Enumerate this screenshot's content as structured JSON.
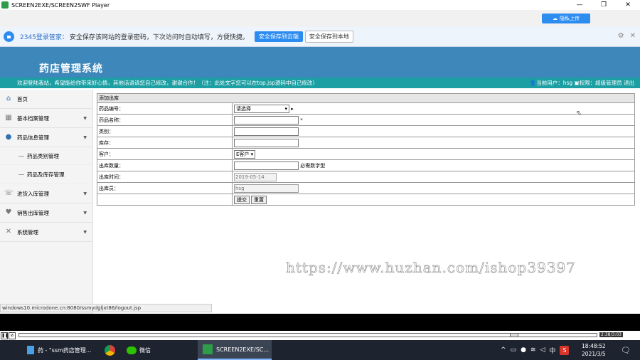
{
  "window": {
    "title": "SCREEN2EXE/SCREEN2SWF Player",
    "controls": [
      "—",
      "❐",
      "✕"
    ]
  },
  "cloud_button": "隐私上传",
  "password_bar": {
    "brand": "2345登录管家：",
    "message": "安全保存该网站的登录密码，下次访问时自动填写，方便快捷。",
    "save_cloud": "安全保存到云端",
    "save_local": "安全保存到本地"
  },
  "header": {
    "system_name": "药店管理系统"
  },
  "welcome": {
    "message": "欢迎登陆我站，希望能给你带来好心情，其他话语请您自己修改，谢谢合作！（注：此处文字您可以在top.jsp源码中自己修改）",
    "user": "当前用户：hsg",
    "role": "权限：超级管理员",
    "logout": "退出"
  },
  "sidebar": {
    "items": [
      {
        "icon": "home-icon",
        "glyph": "⌂",
        "label": "首页"
      },
      {
        "icon": "grid-icon",
        "glyph": "▦",
        "label": "基本档案管理"
      },
      {
        "icon": "user-icon",
        "glyph": "●",
        "label": "药品信息管理"
      },
      {
        "label": "药品类别管理"
      },
      {
        "label": "药品及库存管理"
      },
      {
        "icon": "comment-icon",
        "glyph": "☏",
        "label": "进货入库管理"
      },
      {
        "icon": "heart-icon",
        "glyph": "♥",
        "label": "销售出库管理"
      },
      {
        "icon": "tools-icon",
        "glyph": "✕",
        "label": "系统管理"
      }
    ]
  },
  "form": {
    "header": "添加出库",
    "labels": [
      "药品编号：",
      "药品名称：",
      "类别：",
      "库存：",
      "客户：",
      "出库数量：",
      "出库时间：",
      "出库员："
    ],
    "drug_select": "请选择",
    "required_mark": "*",
    "customer_select": "E客户",
    "quantity_hint": "必需数字型",
    "date_value": "2019-05-14",
    "clerk_value": "hsg",
    "submit": "提交",
    "reset": "重置"
  },
  "watermark": "https://www.huzhan.com/ishop39397",
  "status_url": "windows10.microdone.cn:8080/ssmydgljxt86/logout.jsp",
  "player": {
    "time": "2:38/3:03"
  },
  "taskbar": {
    "apps": [
      "药 - \"ssm药店管理...",
      "微信",
      "SCREEN2EXE/SC..."
    ],
    "time": "18:48:52",
    "date": "2021/3/5",
    "ime": "中",
    "sys_label": "S"
  }
}
